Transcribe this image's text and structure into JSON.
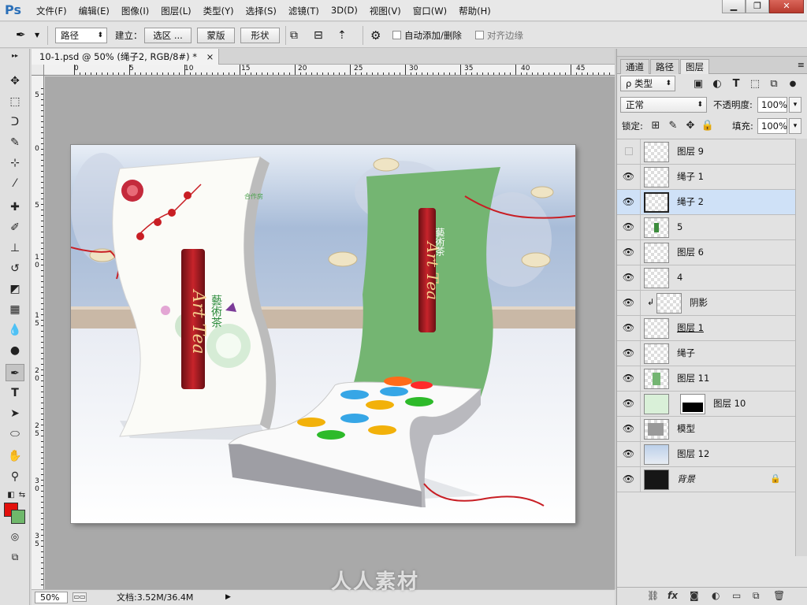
{
  "app": {
    "logo_text": "Ps"
  },
  "menu": {
    "items": [
      "文件(F)",
      "编辑(E)",
      "图像(I)",
      "图层(L)",
      "类型(Y)",
      "选择(S)",
      "滤镜(T)",
      "3D(D)",
      "视图(V)",
      "窗口(W)",
      "帮助(H)"
    ]
  },
  "window_controls": {
    "minimize": "▁",
    "restore": "❐",
    "close": "✕"
  },
  "options_bar": {
    "tool_icon": "pen-tool-icon",
    "mode_value": "路径",
    "make_label": "建立：",
    "selection_button": "选区 ...",
    "mask_button": "蒙版",
    "shape_button": "形状",
    "auto_add_delete_label": "自动添加/删除",
    "align_edges_label": "对齐边缘"
  },
  "toolbox": {
    "tools": [
      "move-tool-icon",
      "marquee-tool-icon",
      "lasso-tool-icon",
      "quick-select-tool-icon",
      "crop-tool-icon",
      "eyedropper-tool-icon",
      "healing-brush-tool-icon",
      "brush-tool-icon",
      "stamp-tool-icon",
      "history-brush-tool-icon",
      "eraser-tool-icon",
      "gradient-tool-icon",
      "blur-tool-icon",
      "dodge-tool-icon",
      "pen-tool-icon",
      "type-tool-icon",
      "path-select-tool-icon",
      "ellipse-tool-icon",
      "hand-tool-icon",
      "zoom-tool-icon"
    ],
    "active_tool": "pen-tool-icon",
    "foreground_color": "#e3100c",
    "background_color": "#6fb86b"
  },
  "document": {
    "tab_title": "10-1.psd @ 50% (绳子2, RGB/8#) *",
    "tab_close": "×",
    "ruler_top_labels": [
      "0",
      "5",
      "10",
      "15",
      "20",
      "25",
      "30",
      "35",
      "40",
      "45"
    ],
    "ruler_left_labels": [
      "5",
      "0",
      "5",
      "1 0",
      "1 5",
      "2 0",
      "2 5",
      "3 0",
      "3 5"
    ],
    "zoom": "50%",
    "doc_info": "文档:3.52M/36.4M",
    "status_arrow": "▶"
  },
  "canvas_art": {
    "left_box_title": "藝術茶",
    "left_box_brand": "合作房",
    "right_box_title": "藝術茶",
    "script_text": "Art Tea"
  },
  "panel": {
    "tabs": [
      "通道",
      "路径",
      "图层"
    ],
    "active_tab": "图层",
    "menu_icon": "≡",
    "filter_kind": "ρ 类型",
    "blend_mode": "正常",
    "opacity_label": "不透明度:",
    "opacity_value": "100%",
    "lock_label": "锁定:",
    "fill_label": "填充:",
    "fill_value": "100%",
    "layers": [
      {
        "name": "图层 9",
        "visible": false,
        "selected": false
      },
      {
        "name": "绳子 1",
        "visible": true,
        "selected": false
      },
      {
        "name": "绳子 2",
        "visible": true,
        "selected": true
      },
      {
        "name": "5",
        "visible": true,
        "selected": false
      },
      {
        "name": "图层 6",
        "visible": true,
        "selected": false
      },
      {
        "name": "4",
        "visible": true,
        "selected": false
      },
      {
        "name": "阴影",
        "visible": true,
        "selected": false,
        "clipped": true
      },
      {
        "name": "图层 1",
        "visible": true,
        "selected": false
      },
      {
        "name": "绳子",
        "visible": true,
        "selected": false
      },
      {
        "name": "图层 11",
        "visible": true,
        "selected": false
      },
      {
        "name": "图层 10",
        "visible": true,
        "selected": false,
        "has_mask": true
      },
      {
        "name": "模型",
        "visible": true,
        "selected": false
      },
      {
        "name": "图层 12",
        "visible": true,
        "selected": false
      },
      {
        "name": "背景",
        "visible": true,
        "selected": false,
        "locked": true
      }
    ]
  },
  "watermark": {
    "text": "人人素材"
  }
}
